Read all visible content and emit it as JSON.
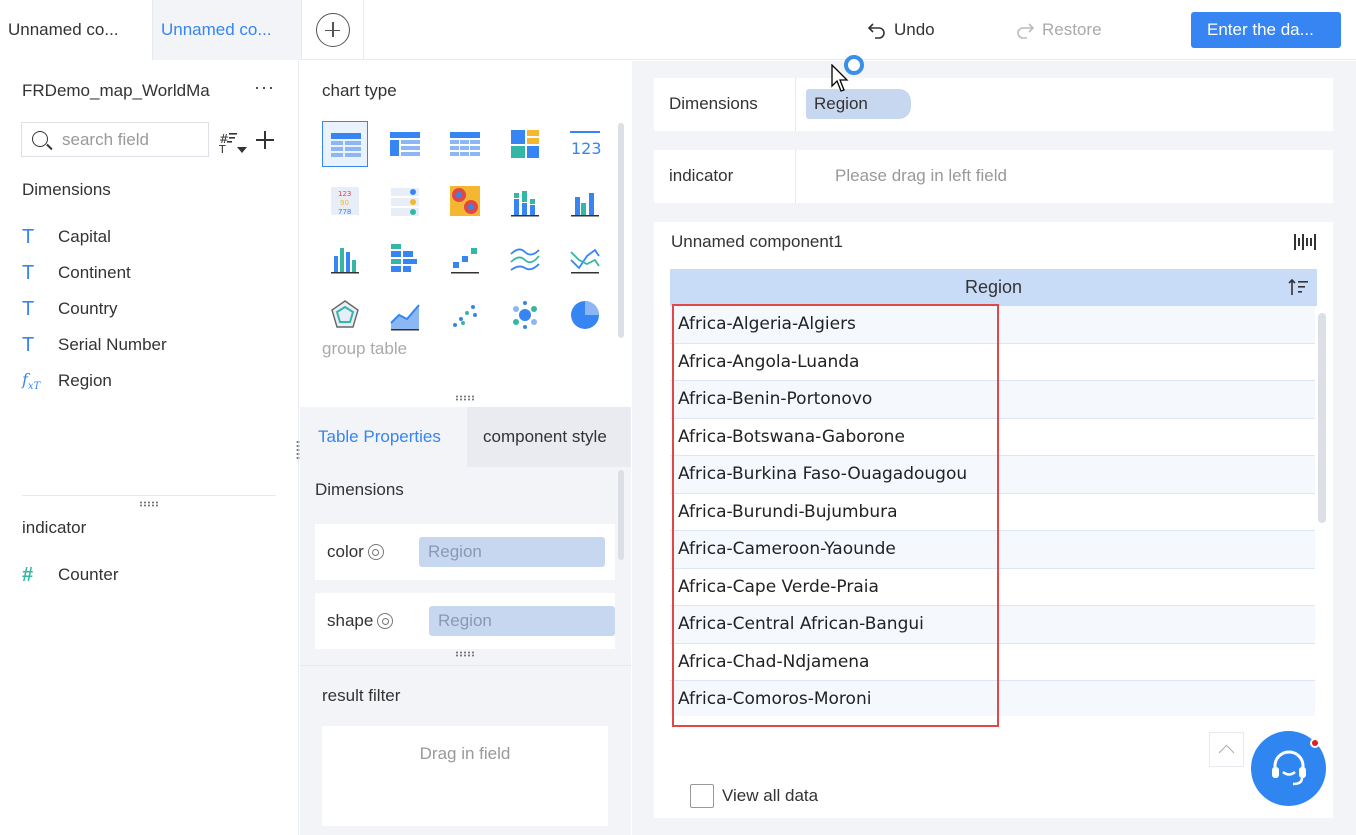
{
  "tabs": [
    {
      "label": "Unnamed co..."
    },
    {
      "label": "Unnamed co..."
    }
  ],
  "toolbar": {
    "undo_label": "Undo",
    "restore_label": "Restore",
    "enter_label": "Enter the da..."
  },
  "left": {
    "dataset_name": "FRDemo_map_WorldMa",
    "search_placeholder": "search field",
    "dimensions_title": "Dimensions",
    "dimensions": [
      {
        "label": "Capital",
        "icon": "text-type-icon"
      },
      {
        "label": "Continent",
        "icon": "text-type-icon"
      },
      {
        "label": "Country",
        "icon": "text-type-icon"
      },
      {
        "label": "Serial Number",
        "icon": "text-type-icon"
      },
      {
        "label": "Region",
        "icon": "formula-text-icon"
      }
    ],
    "indicator_title": "indicator",
    "indicators": [
      {
        "label": "Counter",
        "icon": "number-type-icon"
      }
    ]
  },
  "middle": {
    "chart_type_title": "chart type",
    "chart_type_hint": "group table",
    "props_tab": "Table Properties",
    "style_tab": "component style",
    "props_dimensions_title": "Dimensions",
    "color_label": "color",
    "color_value": "Region",
    "shape_label": "shape",
    "shape_value": "Region",
    "result_filter_title": "result filter",
    "result_filter_hint": "Drag in field"
  },
  "right": {
    "dimensions_label": "Dimensions",
    "dimensions_field": "Region",
    "indicator_label": "indicator",
    "indicator_hint": "Please drag in left field",
    "component_title": "Unnamed component1",
    "table_header": "Region",
    "rows": [
      "Africa-Algeria-Algiers",
      "Africa-Angola-Luanda",
      "Africa-Benin-Portonovo",
      "Africa-Botswana-Gaborone",
      "Africa-Burkina Faso-Ouagadougou",
      "Africa-Burundi-Bujumbura",
      "Africa-Cameroon-Yaounde",
      "Africa-Cape Verde-Praia",
      "Africa-Central African-Bangui",
      "Africa-Chad-Ndjamena",
      "Africa-Comoros-Moroni"
    ],
    "view_all_label": "View all data"
  },
  "colors": {
    "accent": "#3685f2",
    "highlight": "#e04848",
    "table_header": "#c8dcf7"
  }
}
